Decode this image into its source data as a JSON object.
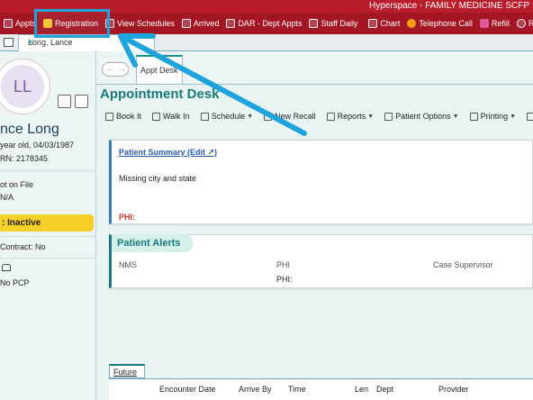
{
  "window": {
    "title": "Hyperspace - FAMILY MEDICINE SCFP"
  },
  "toolbar": {
    "items": [
      {
        "label": "Appts"
      },
      {
        "label": "Registration"
      },
      {
        "label": "View Schedules"
      },
      {
        "label": "Arrived"
      },
      {
        "label": "DAR - Dept Appts"
      },
      {
        "label": "Staff Daily"
      },
      {
        "label": "Chart"
      },
      {
        "label": "Telephone Call"
      },
      {
        "label": "Refill"
      },
      {
        "label": "R"
      }
    ]
  },
  "patient_tab": {
    "label": "Long, Lance",
    "close": "×"
  },
  "patient": {
    "initials": "LL",
    "name": "nce Long",
    "age_dob": "year old, 04/03/1987",
    "mrn": "RN: 2178345",
    "coverage_label": "ot on File",
    "coverage_value": "N/A",
    "status": ": Inactive",
    "contract": " Contract: No",
    "pcp": "No PCP"
  },
  "activity_tab": {
    "label": "Appt Desk"
  },
  "desk": {
    "title": "Appointment Desk",
    "actions": [
      {
        "label": "Book It",
        "dropdown": false
      },
      {
        "label": "Walk In",
        "dropdown": false
      },
      {
        "label": "Schedule",
        "dropdown": true
      },
      {
        "label": "New Recall",
        "dropdown": false
      },
      {
        "label": "Reports",
        "dropdown": true
      },
      {
        "label": "Patient Options",
        "dropdown": true
      },
      {
        "label": "Printing",
        "dropdown": true
      },
      {
        "label": "PC",
        "dropdown": false
      }
    ]
  },
  "summary": {
    "link": "Patient Summary (Edit ↗)",
    "message": "Missing city and state",
    "phi": "PHI:"
  },
  "alerts": {
    "title": "Patient Alerts",
    "columns": [
      "NMS",
      "PHI",
      "Case Supervisor"
    ],
    "phi_value": "PHI:"
  },
  "encounters": {
    "tab": "Future",
    "headers": [
      "Encounter Date",
      "Arrive By",
      "Time",
      "Len",
      "Dept",
      "Provider"
    ]
  },
  "colors": {
    "brand": "#a31624",
    "accent": "#1a7a7a",
    "highlight": "#1ea4dc",
    "status": "#f5cf2a"
  }
}
